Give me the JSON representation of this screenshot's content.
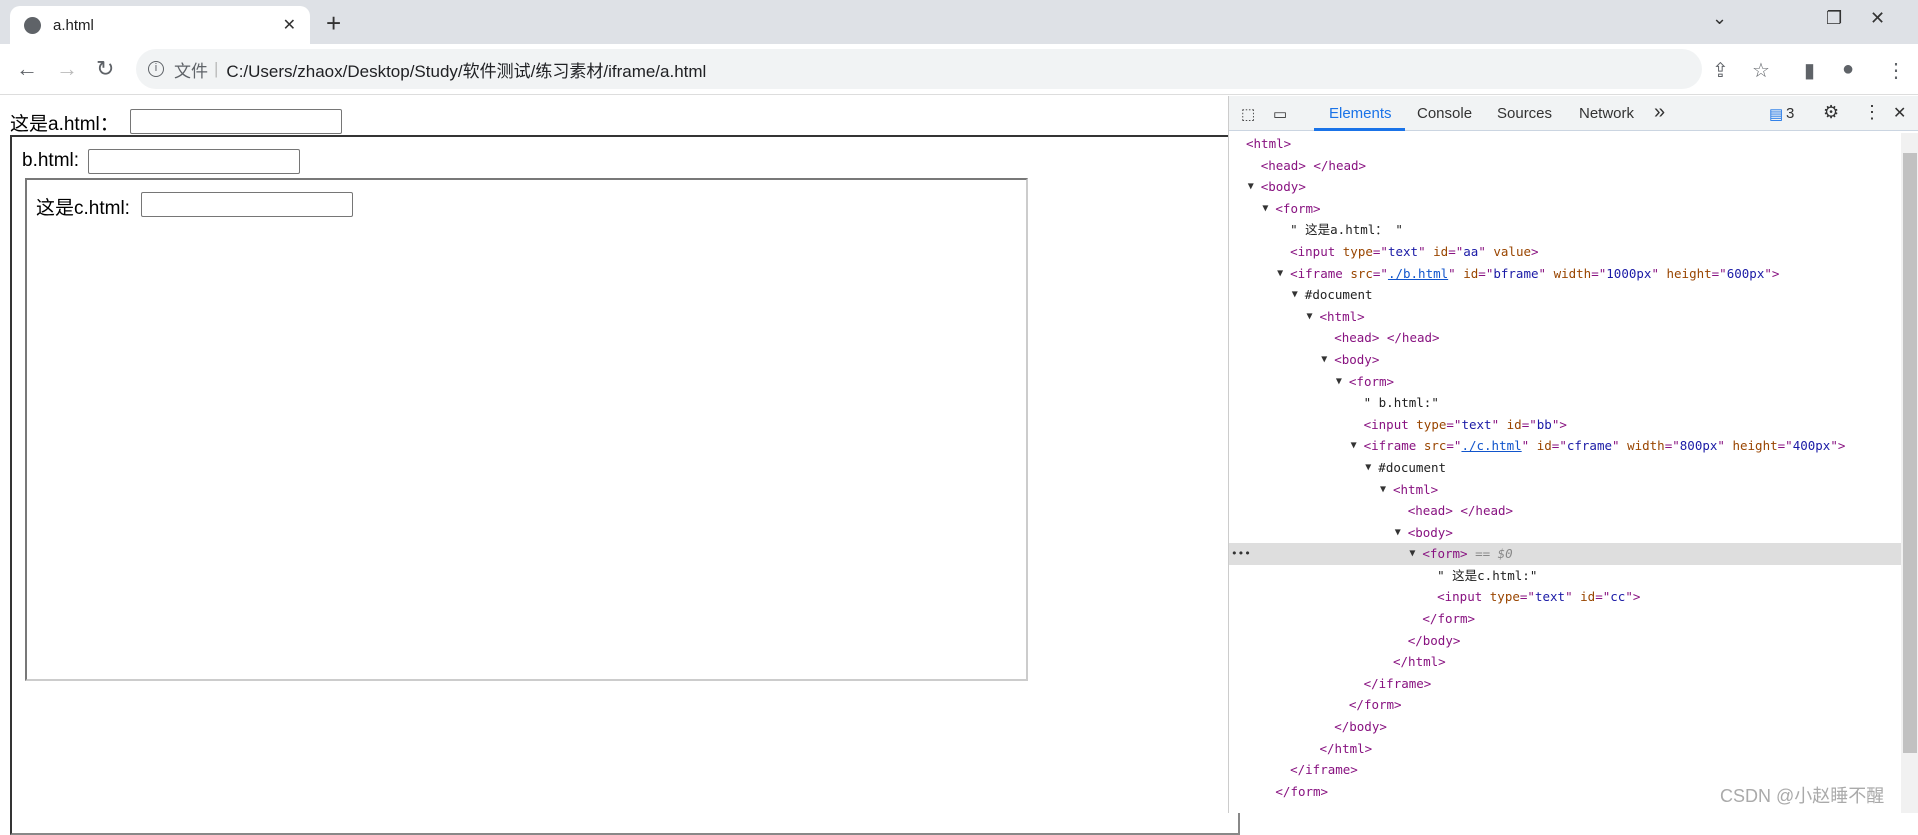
{
  "browser": {
    "tab_title": "a.html",
    "address_prefix": "文件",
    "address": "C:/Users/zhaox/Desktop/Study/软件测试/练习素材/iframe/a.html"
  },
  "page": {
    "a_label": "这是a.html：",
    "b_label": "b.html:",
    "c_label": "这是c.html:"
  },
  "devtools": {
    "tabs": [
      "Elements",
      "Console",
      "Sources",
      "Network"
    ],
    "more": "»",
    "issues_count": "3",
    "selected_marker": "==",
    "selected_var": "$0",
    "ellipsis": "•••"
  },
  "tree": [
    {
      "l": 0,
      "a": 0,
      "k": [
        [
          "tag",
          "<html>"
        ]
      ]
    },
    {
      "l": 1,
      "a": 0,
      "k": [
        [
          "tag",
          "<head> </head>"
        ]
      ]
    },
    {
      "l": 1,
      "a": 1,
      "k": [
        [
          "tag",
          "<body>"
        ]
      ]
    },
    {
      "l": 2,
      "a": 1,
      "k": [
        [
          "tag",
          "<form>"
        ]
      ]
    },
    {
      "l": 3,
      "a": 0,
      "k": [
        [
          "txt",
          "\" 这是a.html： \""
        ]
      ]
    },
    {
      "l": 3,
      "a": 0,
      "k": [
        [
          "tag",
          "<input "
        ],
        [
          "attr",
          "type"
        ],
        [
          "tag",
          "=\""
        ],
        [
          "val",
          "text"
        ],
        [
          "tag",
          "\" "
        ],
        [
          "attr",
          "id"
        ],
        [
          "tag",
          "=\""
        ],
        [
          "val",
          "aa"
        ],
        [
          "tag",
          "\" "
        ],
        [
          "attr",
          "value"
        ],
        [
          "tag",
          ">"
        ]
      ]
    },
    {
      "l": 3,
      "a": 1,
      "k": [
        [
          "tag",
          "<iframe "
        ],
        [
          "attr",
          "src"
        ],
        [
          "tag",
          "=\""
        ],
        [
          "link",
          "./b.html"
        ],
        [
          "tag",
          "\" "
        ],
        [
          "attr",
          "id"
        ],
        [
          "tag",
          "=\""
        ],
        [
          "val",
          "bframe"
        ],
        [
          "tag",
          "\" "
        ],
        [
          "attr",
          "width"
        ],
        [
          "tag",
          "=\""
        ],
        [
          "val",
          "1000px"
        ],
        [
          "tag",
          "\" "
        ],
        [
          "attr",
          "height"
        ],
        [
          "tag",
          "=\""
        ],
        [
          "val",
          "600px"
        ],
        [
          "tag",
          "\">"
        ]
      ]
    },
    {
      "l": 4,
      "a": 1,
      "k": [
        [
          "txt",
          "#document"
        ]
      ]
    },
    {
      "l": 5,
      "a": 1,
      "k": [
        [
          "tag",
          "<html>"
        ]
      ]
    },
    {
      "l": 6,
      "a": 0,
      "k": [
        [
          "tag",
          "<head> </head>"
        ]
      ]
    },
    {
      "l": 6,
      "a": 1,
      "k": [
        [
          "tag",
          "<body>"
        ]
      ]
    },
    {
      "l": 7,
      "a": 1,
      "k": [
        [
          "tag",
          "<form>"
        ]
      ]
    },
    {
      "l": 8,
      "a": 0,
      "k": [
        [
          "txt",
          "\" b.html:\""
        ]
      ]
    },
    {
      "l": 8,
      "a": 0,
      "k": [
        [
          "tag",
          "<input "
        ],
        [
          "attr",
          "type"
        ],
        [
          "tag",
          "=\""
        ],
        [
          "val",
          "text"
        ],
        [
          "tag",
          "\" "
        ],
        [
          "attr",
          "id"
        ],
        [
          "tag",
          "=\""
        ],
        [
          "val",
          "bb"
        ],
        [
          "tag",
          "\">"
        ]
      ]
    },
    {
      "l": 8,
      "a": 1,
      "k": [
        [
          "tag",
          "<iframe "
        ],
        [
          "attr",
          "src"
        ],
        [
          "tag",
          "=\""
        ],
        [
          "link",
          "./c.html"
        ],
        [
          "tag",
          "\" "
        ],
        [
          "attr",
          "id"
        ],
        [
          "tag",
          "=\""
        ],
        [
          "val",
          "cframe"
        ],
        [
          "tag",
          "\" "
        ],
        [
          "attr",
          "width"
        ],
        [
          "tag",
          "=\""
        ],
        [
          "val",
          "800px"
        ],
        [
          "tag",
          "\" "
        ],
        [
          "attr",
          "height"
        ],
        [
          "tag",
          "=\""
        ],
        [
          "val",
          "400px"
        ],
        [
          "tag",
          "\">"
        ]
      ]
    },
    {
      "l": 9,
      "a": 1,
      "k": [
        [
          "txt",
          "#document"
        ]
      ]
    },
    {
      "l": 10,
      "a": 1,
      "k": [
        [
          "tag",
          "<html>"
        ]
      ]
    },
    {
      "l": 11,
      "a": 0,
      "k": [
        [
          "tag",
          "<head> </head>"
        ]
      ]
    },
    {
      "l": 11,
      "a": 1,
      "k": [
        [
          "tag",
          "<body>"
        ]
      ]
    },
    {
      "l": 12,
      "a": 1,
      "s": 1,
      "k": [
        [
          "tag",
          "<form>"
        ],
        [
          "dim",
          " == $0"
        ]
      ]
    },
    {
      "l": 13,
      "a": 0,
      "k": [
        [
          "txt",
          "\" 这是c.html:\""
        ]
      ]
    },
    {
      "l": 13,
      "a": 0,
      "k": [
        [
          "tag",
          "<input "
        ],
        [
          "attr",
          "type"
        ],
        [
          "tag",
          "=\""
        ],
        [
          "val",
          "text"
        ],
        [
          "tag",
          "\" "
        ],
        [
          "attr",
          "id"
        ],
        [
          "tag",
          "=\""
        ],
        [
          "val",
          "cc"
        ],
        [
          "tag",
          "\">"
        ]
      ]
    },
    {
      "l": 12,
      "a": 0,
      "k": [
        [
          "tag",
          "</form>"
        ]
      ]
    },
    {
      "l": 11,
      "a": 0,
      "k": [
        [
          "tag",
          "</body>"
        ]
      ]
    },
    {
      "l": 10,
      "a": 0,
      "k": [
        [
          "tag",
          "</html>"
        ]
      ]
    },
    {
      "l": 8,
      "a": 0,
      "k": [
        [
          "tag",
          "</iframe>"
        ]
      ]
    },
    {
      "l": 7,
      "a": 0,
      "k": [
        [
          "tag",
          "</form>"
        ]
      ]
    },
    {
      "l": 6,
      "a": 0,
      "k": [
        [
          "tag",
          "</body>"
        ]
      ]
    },
    {
      "l": 5,
      "a": 0,
      "k": [
        [
          "tag",
          "</html>"
        ]
      ]
    },
    {
      "l": 3,
      "a": 0,
      "k": [
        [
          "tag",
          "</iframe>"
        ]
      ]
    },
    {
      "l": 2,
      "a": 0,
      "k": [
        [
          "tag",
          "</form>"
        ]
      ]
    }
  ],
  "watermark": "CSDN @小赵睡不醒"
}
